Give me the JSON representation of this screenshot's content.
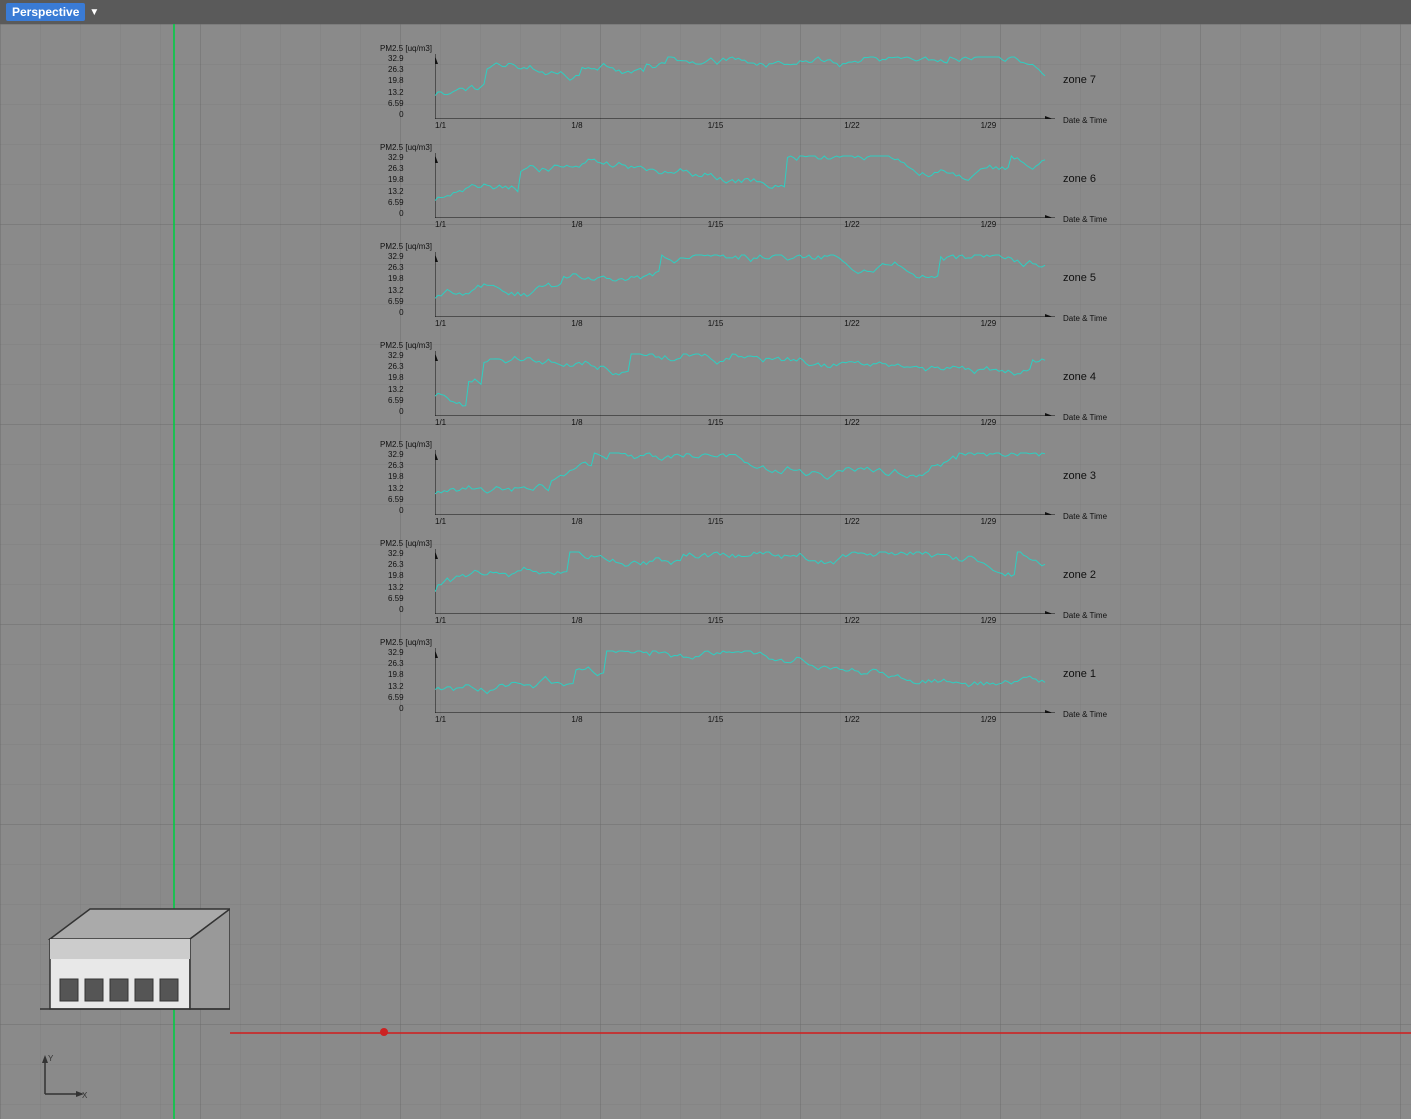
{
  "header": {
    "perspective_label": "Perspective",
    "dropdown_icon": "▼"
  },
  "viewport": {
    "background_color": "#8a8a8a",
    "grid_color": "#6a6a6a"
  },
  "charts": [
    {
      "zone": "zone 7",
      "y_title": "PM2.5 [uq/m3]",
      "y_labels": [
        "32.9",
        "26.3",
        "19.8",
        "13.2",
        "6.59",
        "0"
      ],
      "x_labels": [
        "1/1",
        "1/8",
        "1/15",
        "1/22",
        "1/29"
      ],
      "x_title": "Date & Time"
    },
    {
      "zone": "zone 6",
      "y_title": "PM2.5 [uq/m3]",
      "y_labels": [
        "32.9",
        "26.3",
        "19.8",
        "13.2",
        "6.59",
        "0"
      ],
      "x_labels": [
        "1/1",
        "1/8",
        "1/15",
        "1/22",
        "1/29"
      ],
      "x_title": "Date & Time"
    },
    {
      "zone": "zone 5",
      "y_title": "PM2.5 [uq/m3]",
      "y_labels": [
        "32.9",
        "26.3",
        "19.8",
        "13.2",
        "6.59",
        "0"
      ],
      "x_labels": [
        "1/1",
        "1/8",
        "1/15",
        "1/22",
        "1/29"
      ],
      "x_title": "Date & Time"
    },
    {
      "zone": "zone 4",
      "y_title": "PM2.5 [uq/m3]",
      "y_labels": [
        "32.9",
        "26.3",
        "19.8",
        "13.2",
        "6.59",
        "0"
      ],
      "x_labels": [
        "1/1",
        "1/8",
        "1/15",
        "1/22",
        "1/29"
      ],
      "x_title": "Date & Time"
    },
    {
      "zone": "zone 3",
      "y_title": "PM2.5 [uq/m3]",
      "y_labels": [
        "32.9",
        "26.3",
        "19.8",
        "13.2",
        "6.59",
        "0"
      ],
      "x_labels": [
        "1/1",
        "1/8",
        "1/15",
        "1/22",
        "1/29"
      ],
      "x_title": "Date & Time"
    },
    {
      "zone": "zone 2",
      "y_title": "PM2.5 [uq/m3]",
      "y_labels": [
        "32.9",
        "26.3",
        "19.8",
        "13.2",
        "6.59",
        "0"
      ],
      "x_labels": [
        "1/1",
        "1/8",
        "1/15",
        "1/22",
        "1/29"
      ],
      "x_title": "Date & Time"
    },
    {
      "zone": "zone 1",
      "y_title": "PM2.5 [uq/m3]",
      "y_labels": [
        "32.9",
        "26.3",
        "19.8",
        "13.2",
        "6.59",
        "0"
      ],
      "x_labels": [
        "1/1",
        "1/8",
        "1/15",
        "1/22",
        "1/29"
      ],
      "x_title": "Date & Time"
    }
  ]
}
